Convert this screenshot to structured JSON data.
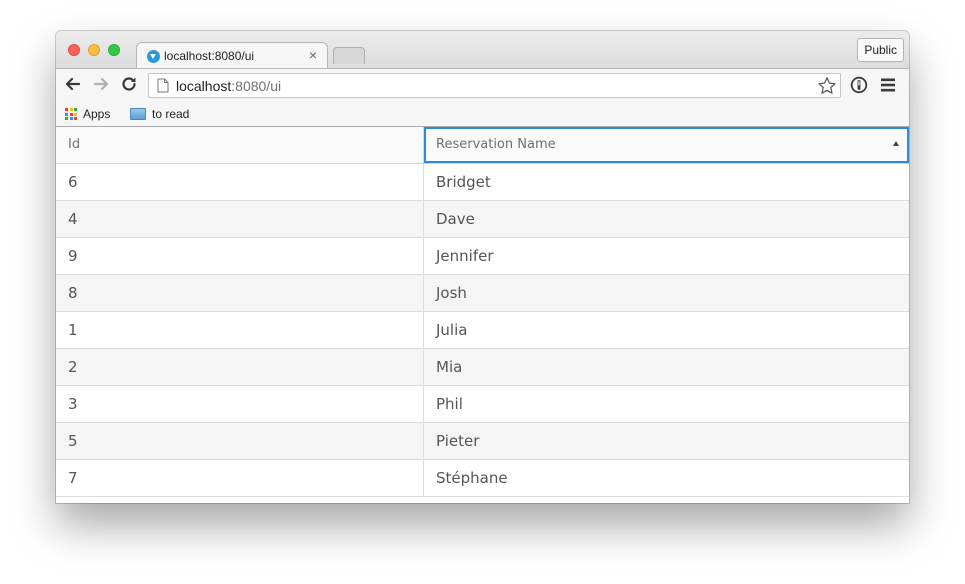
{
  "browser": {
    "tab_title": "localhost:8080/ui",
    "tab_close": "×",
    "profile_button": "Public",
    "url_host": "localhost",
    "url_rest": ":8080/ui",
    "bookmarks": [
      {
        "label": "Apps",
        "icon": "apps-grid-icon"
      },
      {
        "label": "to read",
        "icon": "folder-icon"
      }
    ]
  },
  "grid": {
    "columns": [
      {
        "label": "Id"
      },
      {
        "label": "Reservation Name",
        "sorted": "ascending"
      }
    ],
    "rows": [
      {
        "id": "6",
        "name": "Bridget"
      },
      {
        "id": "4",
        "name": "Dave"
      },
      {
        "id": "9",
        "name": "Jennifer"
      },
      {
        "id": "8",
        "name": "Josh"
      },
      {
        "id": "1",
        "name": "Julia"
      },
      {
        "id": "2",
        "name": "Mia"
      },
      {
        "id": "3",
        "name": "Phil"
      },
      {
        "id": "5",
        "name": "Pieter"
      },
      {
        "id": "7",
        "name": "Stéphane"
      }
    ]
  },
  "colors": {
    "selected_header_border": "#2b8ae0",
    "alt_row": "#f5f5f5"
  }
}
